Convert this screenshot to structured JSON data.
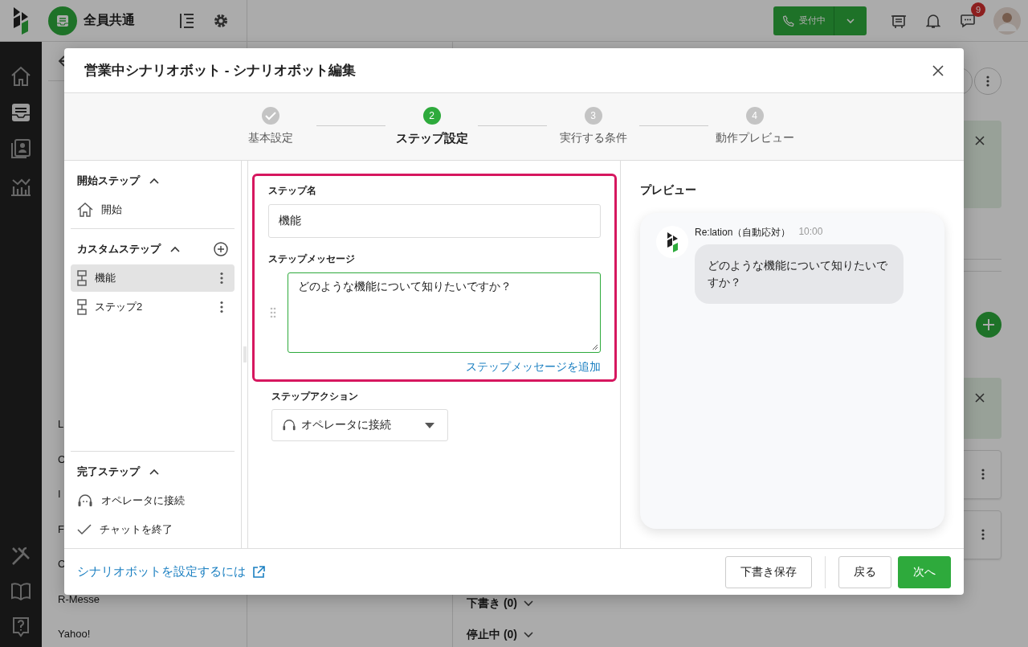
{
  "topbar": {
    "workspace": "全員共通",
    "status_button": "受付中",
    "notification_count": "9"
  },
  "background": {
    "sidebar_items": [
      {
        "label": "L"
      },
      {
        "label": "C"
      },
      {
        "label": "I"
      },
      {
        "label": "F"
      },
      {
        "label": "C"
      },
      {
        "label": "R-Messe"
      },
      {
        "label": "Yahoo!"
      }
    ],
    "groups": [
      {
        "label": "下書き (0)"
      },
      {
        "label": "停止中 (0)"
      }
    ]
  },
  "modal": {
    "title": "営業中シナリオボット - シナリオボット編集",
    "steps": [
      {
        "label": "基本設定",
        "done": true,
        "selected": false
      },
      {
        "label": "ステップ設定",
        "number": "2",
        "done": false,
        "selected": true
      },
      {
        "label": "実行する条件",
        "number": "3",
        "done": false,
        "selected": false
      },
      {
        "label": "動作プレビュー",
        "number": "4",
        "done": false,
        "selected": false
      }
    ],
    "step_sections": [
      {
        "title": "開始ステップ",
        "expanded": true,
        "can_add": false,
        "items": [
          {
            "label": "開始",
            "kind": "start",
            "selected": false
          }
        ]
      },
      {
        "title": "カスタムステップ",
        "expanded": true,
        "can_add": true,
        "items": [
          {
            "label": "機能",
            "kind": "custom",
            "selected": true
          },
          {
            "label": "ステップ2",
            "kind": "custom",
            "selected": false
          }
        ]
      },
      {
        "title": "完了ステップ",
        "expanded": true,
        "can_add": false,
        "items": [
          {
            "label": "オペレータに接続",
            "kind": "operator",
            "selected": false
          },
          {
            "label": "チャットを終了",
            "kind": "end",
            "selected": false
          }
        ]
      }
    ],
    "form": {
      "highlighted": true,
      "name_label": "ステップ名",
      "name_value": "機能",
      "message_label": "ステップメッセージ",
      "message_value": "どのような機能について知りたいですか？",
      "add_message_link": "ステップメッセージを追加",
      "action_label": "ステップアクション",
      "action_value": "オペレータに接続"
    },
    "preview": {
      "title": "プレビュー",
      "sender": "Re:lation（自動応対）",
      "time": "10:00",
      "message": "どのような機能について知りたいですか？"
    },
    "help_link": "シナリオボットを設定するには",
    "buttons": [
      {
        "label": "下書き保存",
        "kind": "secondary"
      },
      {
        "label": "戻る",
        "kind": "secondary"
      },
      {
        "label": "次へ",
        "kind": "primary"
      }
    ]
  }
}
